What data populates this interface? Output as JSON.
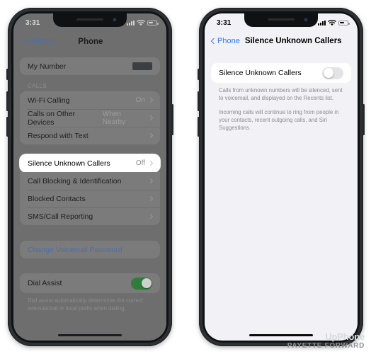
{
  "colors": {
    "ios_blue": "#3478f6",
    "toggle_on_green": "#34c759",
    "screen_dimmed": "#6e6e6e",
    "screen_normal": "#f2f2f6",
    "watermark_light": "#d8d9dd",
    "watermark_dark": "#8d9096"
  },
  "left_phone": {
    "status": {
      "time": "3:31",
      "signal": "signal-bars-icon",
      "wifi": "wifi-icon",
      "battery": "battery-icon"
    },
    "nav": {
      "back_label": "Settings",
      "title": "Phone"
    },
    "groups": [
      {
        "header": "",
        "rows": [
          {
            "label": "My Number",
            "value": "",
            "redacted": true,
            "chevron": false
          }
        ]
      },
      {
        "header": "CALLS",
        "rows": [
          {
            "label": "Wi-Fi Calling",
            "value": "On",
            "chevron": true
          },
          {
            "label": "Calls on Other Devices",
            "value": "When Nearby",
            "chevron": true
          },
          {
            "label": "Respond with Text",
            "value": "",
            "chevron": true
          }
        ]
      },
      {
        "header": "",
        "highlight": true,
        "rows": [
          {
            "label": "Silence Unknown Callers",
            "value": "Off",
            "chevron": true
          }
        ]
      },
      {
        "header": "",
        "rows": [
          {
            "label": "Call Blocking & Identification",
            "value": "",
            "chevron": true
          },
          {
            "label": "Blocked Contacts",
            "value": "",
            "chevron": true
          },
          {
            "label": "SMS/Call Reporting",
            "value": "",
            "chevron": true
          }
        ]
      },
      {
        "header": "",
        "rows": [
          {
            "label": "Change Voicemail Password",
            "value": "",
            "chevron": false,
            "link": true
          }
        ]
      },
      {
        "header": "",
        "rows": [
          {
            "label": "Dial Assist",
            "value": "",
            "toggle": "on",
            "chevron": false
          }
        ]
      }
    ],
    "footnote": "Dial assist automatically determines the correct international or local prefix when dialing."
  },
  "right_phone": {
    "status": {
      "time": "3:31",
      "signal": "signal-bars-icon",
      "wifi": "wifi-icon",
      "battery": "battery-icon"
    },
    "nav": {
      "back_label": "Phone",
      "title": "Silence Unknown Callers"
    },
    "groups": [
      {
        "header": "",
        "rows": [
          {
            "label": "Silence Unknown Callers",
            "value": "",
            "toggle": "off",
            "chevron": false
          }
        ]
      }
    ],
    "footnote_paragraphs": [
      "Calls from unknown numbers will be silenced, sent to voicemail, and displayed on the Recents list.",
      "Incoming calls will continue to ring from people in your contacts, recent outgoing calls, and Siri Suggestions."
    ]
  },
  "watermark": {
    "brand": "UpPhone",
    "publisher": "PAYETTE FORWARD"
  }
}
